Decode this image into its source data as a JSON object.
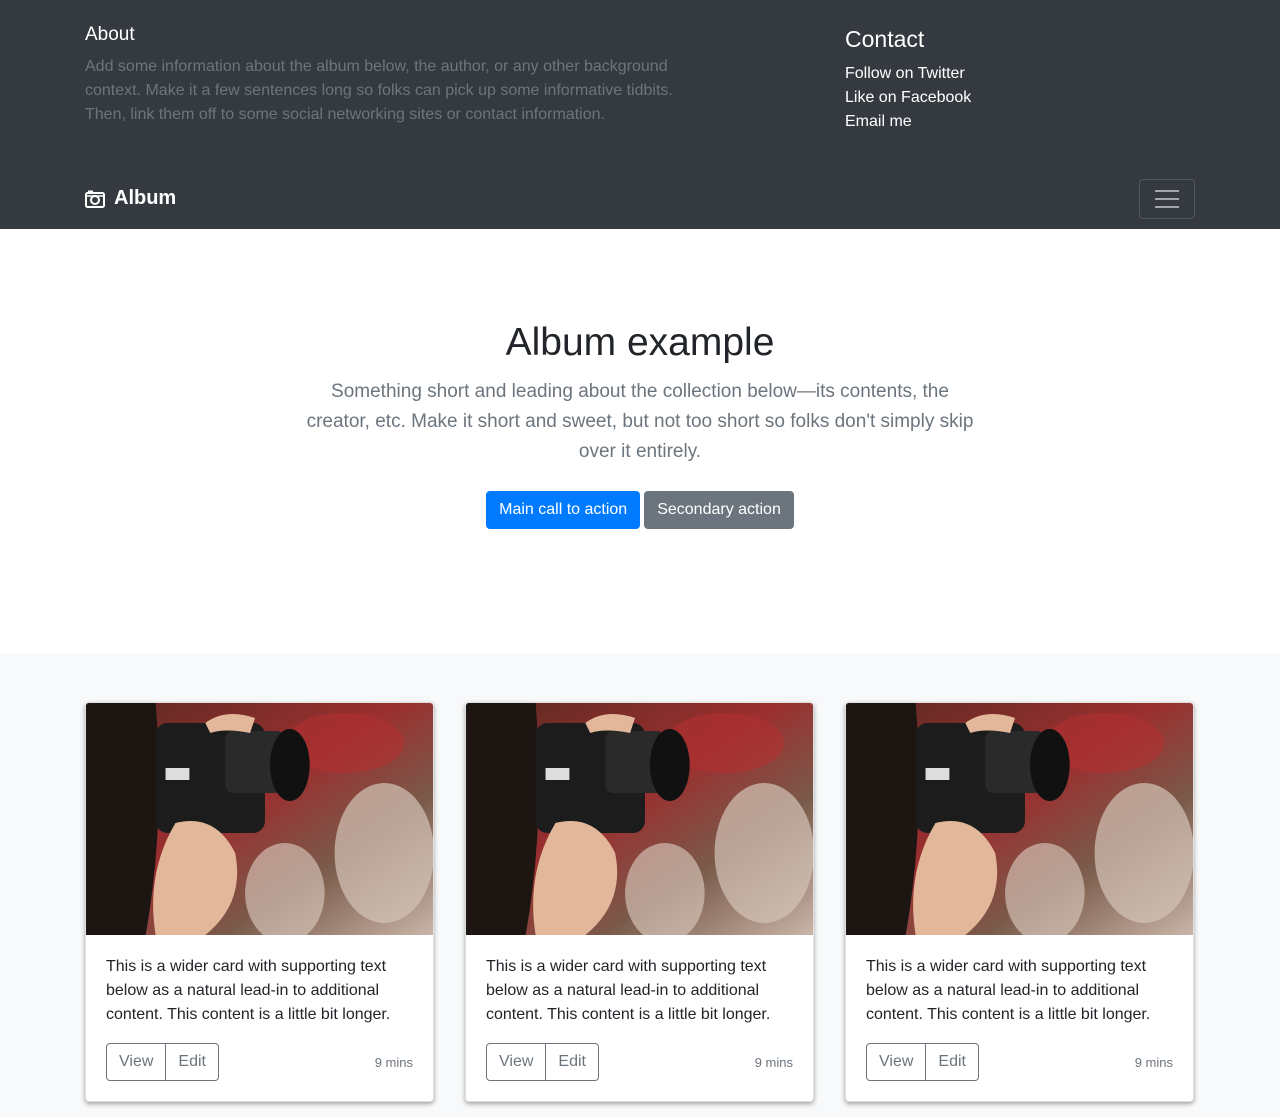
{
  "header": {
    "about_title": "About",
    "about_text": "Add some information about the album below, the author, or any other background context. Make it a few sentences long so folks can pick up some informative tidbits. Then, link them off to some social networking sites or contact information.",
    "contact_title": "Contact",
    "contact_links": [
      "Follow on Twitter",
      "Like on Facebook",
      "Email me"
    ]
  },
  "navbar": {
    "brand": "Album"
  },
  "jumbotron": {
    "heading": "Album example",
    "lead": "Something short and leading about the collection below—its contents, the creator, etc. Make it short and sweet, but not too short so folks don't simply skip over it entirely.",
    "primary_button": "Main call to action",
    "secondary_button": "Secondary action"
  },
  "cards": [
    {
      "text": "This is a wider card with supporting text below as a natural lead-in to additional content. This content is a little bit longer.",
      "view": "View",
      "edit": "Edit",
      "time": "9 mins"
    },
    {
      "text": "This is a wider card with supporting text below as a natural lead-in to additional content. This content is a little bit longer.",
      "view": "View",
      "edit": "Edit",
      "time": "9 mins"
    },
    {
      "text": "This is a wider card with supporting text below as a natural lead-in to additional content. This content is a little bit longer.",
      "view": "View",
      "edit": "Edit",
      "time": "9 mins"
    }
  ],
  "colors": {
    "dark": "#343a40",
    "primary": "#007bff",
    "secondary": "#6c757d",
    "light": "#f8f9fa"
  }
}
